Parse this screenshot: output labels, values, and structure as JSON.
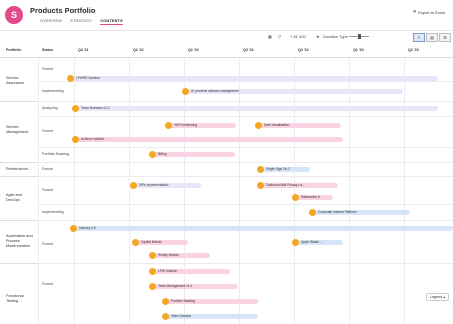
{
  "header": {
    "logo_letter": "S",
    "title": "Products Portfolio",
    "tabs": [
      {
        "label": "OVERVIEW"
      },
      {
        "label": "STRATEGY"
      },
      {
        "label": "CONTENTS"
      }
    ],
    "export_label": "Export to Excel"
  },
  "toolbar": {
    "zoom_label": "+ 61 000",
    "duration_label": "Duration Type"
  },
  "columns": {
    "portfolio": "Portfolio",
    "status": "Status",
    "quarters": [
      "Q4 '21",
      "Q1 '22",
      "Q2 '22",
      "Q3 '22",
      "Q4 '22",
      "Q1 '23",
      "Q2 '23"
    ]
  },
  "portfolios": [
    {
      "label": "Service Assurance",
      "rows": [
        {
          "status": "Funnel",
          "items": [
            {
              "label": "LPWRR Solution",
              "color": "#e8e6f9"
            }
          ]
        },
        {
          "status": "Implementing",
          "items": [
            {
              "label": "AI powered network management",
              "color": "#e8e6f9"
            }
          ]
        }
      ]
    },
    {
      "label": "Service Management",
      "rows": [
        {
          "status": "Analyzing",
          "items": [
            {
              "label": "Team Business v1.0",
              "color": "#e8e6f9"
            }
          ]
        },
        {
          "status": "Funnel",
          "items": [
            {
              "label": "VM Provisioning",
              "color": "#f9d3e4"
            },
            {
              "label": "Data Visualization",
              "color": "#f9d3e4"
            },
            {
              "label": "Achieve solution",
              "color": "#f9d3e4"
            }
          ]
        },
        {
          "status": "Portfolio Backlog",
          "items": [
            {
              "label": "Billing",
              "color": "#f9d3e4"
            }
          ]
        }
      ]
    },
    {
      "label": "Performance…",
      "rows": [
        {
          "status": "Funnel",
          "items": [
            {
              "label": "Single Sign On 2",
              "color": "#d6e6f8"
            }
          ]
        }
      ]
    },
    {
      "label": "Agile and DevOps",
      "rows": [
        {
          "status": "Funnel",
          "items": [
            {
              "label": "DiPe implementation",
              "color": "#e8e6f9"
            },
            {
              "label": "California Mail Privacy La…",
              "color": "#f9d3e4"
            },
            {
              "label": "Rationalize In",
              "color": "#f9d3e4"
            }
          ]
        },
        {
          "status": "Implementing",
          "items": [
            {
              "label": "Corporate Intranet Platform",
              "color": "#d6e6f8"
            }
          ]
        }
      ]
    },
    {
      "label": "Automation and Process Modernization",
      "rows": [
        {
          "status": "Funnel",
          "items": [
            {
              "label": "Industry 4.0",
              "color": "#d6e6f8"
            },
            {
              "label": "Capital Market",
              "color": "#f9d3e4"
            },
            {
              "label": "Apple Watch …",
              "color": "#d6e6f8"
            },
            {
              "label": "Smoky Islands",
              "color": "#f9d3e4"
            }
          ]
        }
      ]
    },
    {
      "label": "Functional Testing",
      "rows": [
        {
          "status": "Funnel",
          "items": [
            {
              "label": "LPW Solution",
              "color": "#f9d3e4"
            },
            {
              "label": "Team Management v1.0",
              "color": "#f9d3e4"
            },
            {
              "label": "Portfolio Backlog",
              "color": "#f9d3e4"
            },
            {
              "label": "Team Solution",
              "color": "#d6e6f8"
            }
          ]
        }
      ]
    }
  ],
  "legend_label": "Legend"
}
